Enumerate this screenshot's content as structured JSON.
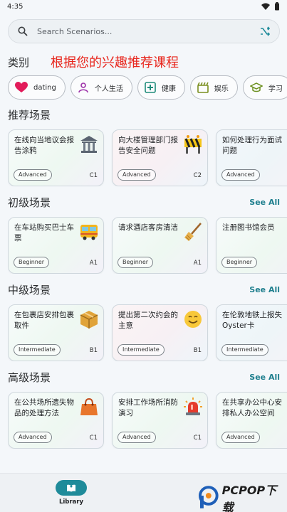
{
  "status_bar": {
    "time": "4:35"
  },
  "search": {
    "placeholder": "Search Scenarios..."
  },
  "categories": {
    "title": "类别",
    "banner": "根据您的兴趣推荐课程",
    "chips": [
      {
        "label": "dating",
        "icon": "heart-icon"
      },
      {
        "label": "个人生活",
        "icon": "person-icon"
      },
      {
        "label": "健康",
        "icon": "health-plus-icon"
      },
      {
        "label": "娱乐",
        "icon": "clapperboard-icon"
      },
      {
        "label": "学习",
        "icon": "graduation-cap-icon"
      }
    ]
  },
  "sections": [
    {
      "title": "推荐场景",
      "see_all": "",
      "cards": [
        {
          "title": "在线向当地议会报告涂鸦",
          "level": "Advanced",
          "grade": "C1",
          "icon": "government-building-icon"
        },
        {
          "title": "向大楼管理部门报告安全问题",
          "level": "Advanced",
          "grade": "C2",
          "icon": "construction-barrier-icon"
        },
        {
          "title": "如何处理行为面试问题",
          "level": "Advanced",
          "grade": "",
          "icon": ""
        }
      ]
    },
    {
      "title": "初级场景",
      "see_all": "See All",
      "cards": [
        {
          "title": "在车站购买巴士车票",
          "level": "Beginner",
          "grade": "A1",
          "icon": "bus-icon"
        },
        {
          "title": "请求酒店客房清洁",
          "level": "Beginner",
          "grade": "A1",
          "icon": "broom-icon"
        },
        {
          "title": "注册图书馆会员",
          "level": "Beginner",
          "grade": "",
          "icon": ""
        }
      ]
    },
    {
      "title": "中级场景",
      "see_all": "See All",
      "cards": [
        {
          "title": "在包裹店安排包裹取件",
          "level": "Intermediate",
          "grade": "B1",
          "icon": "package-icon"
        },
        {
          "title": "提出第二次约会的主意",
          "level": "Intermediate",
          "grade": "B1",
          "icon": "smiling-face-icon"
        },
        {
          "title": "在伦敦地铁上报失Oyster卡",
          "level": "Intermediate",
          "grade": "",
          "icon": ""
        }
      ]
    },
    {
      "title": "高级场景",
      "see_all": "See All",
      "cards": [
        {
          "title": "在公共场所遗失物品的处理方法",
          "level": "Advanced",
          "grade": "C1",
          "icon": "handbag-icon"
        },
        {
          "title": "安排工作场所消防演习",
          "level": "Advanced",
          "grade": "C1",
          "icon": "siren-icon"
        },
        {
          "title": "在共享办公中心安排私人办公空间",
          "level": "Advanced",
          "grade": "",
          "icon": ""
        }
      ]
    }
  ],
  "bottom_nav": {
    "library_label": "Library",
    "second_label": ""
  },
  "watermark": {
    "text": "PCPOP下载"
  }
}
